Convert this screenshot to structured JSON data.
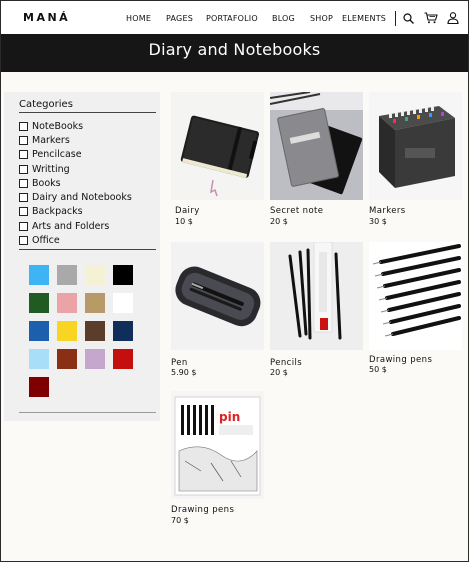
{
  "brand": {
    "logo": "MANÁ"
  },
  "nav": {
    "items": [
      "HOME",
      "PAGES",
      "PORTAFOLIO",
      "BLOG",
      "SHOP",
      "ELEMENTS"
    ],
    "icons": [
      "search-icon",
      "cart-icon",
      "user-icon"
    ]
  },
  "banner": {
    "title": "Diary and Notebooks"
  },
  "sidebar": {
    "heading": "Categories",
    "categories": [
      "NoteBooks",
      "Markers",
      "Pencilcase",
      "Writting",
      "Books",
      "Dairy and Notebooks",
      "Backpacks",
      "Arts and Folders",
      "Office"
    ],
    "swatches": [
      "#3db5f5",
      "#a9a9a9",
      "#f4f1d4",
      "#000000",
      "#1f5b22",
      "#eaa3a6",
      "#b89a6a",
      "#ffffff",
      "#1c5fad",
      "#f7d522",
      "#5a3e2b",
      "#0f2f5a",
      "#a8def7",
      "#8a2e16",
      "#c7a6cd",
      "#c50f0f",
      "#7f0000"
    ]
  },
  "products": [
    {
      "name": "Dairy",
      "price": "10 $",
      "image": "black-notebook"
    },
    {
      "name": "Secret note",
      "price": "20 $",
      "image": "grey-notebooks"
    },
    {
      "name": "Markers",
      "price": "30 $",
      "image": "marker-set"
    },
    {
      "name": "Pen",
      "price": "5.90 $",
      "image": "pen-case"
    },
    {
      "name": "Pencils",
      "price": "20 $",
      "image": "black-pencils"
    },
    {
      "name": "Drawing pens",
      "price": "50 $",
      "image": "drawing-pens"
    },
    {
      "name": "Drawing pens",
      "price": "70 $",
      "image": "drawing-pen-pack"
    }
  ]
}
